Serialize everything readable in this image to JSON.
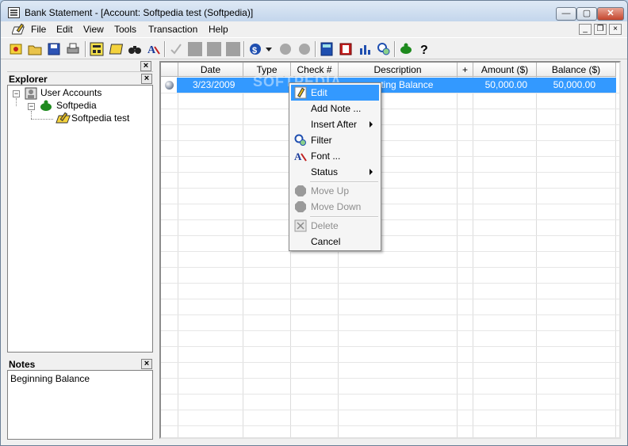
{
  "window": {
    "title": "Bank Statement - [Account: Softpedia test (Softpedia)]"
  },
  "menu": {
    "items": [
      "File",
      "Edit",
      "View",
      "Tools",
      "Transaction",
      "Help"
    ]
  },
  "explorer": {
    "title": "Explorer",
    "tree": {
      "root": "User Accounts",
      "child": "Softpedia",
      "grandchild": "Softpedia test"
    }
  },
  "notes": {
    "title": "Notes",
    "content": "Beginning Balance"
  },
  "grid": {
    "columns": [
      "Date",
      "Type",
      "Check #",
      "Description",
      "+",
      "Amount ($)",
      "Balance ($)"
    ],
    "rows": [
      {
        "date": "3/23/2009",
        "type": "",
        "check": "",
        "description": "... ting Balance",
        "amount": "50,000.00",
        "balance": "50,000.00"
      }
    ]
  },
  "context_menu": {
    "items": [
      {
        "label": "Edit",
        "state": "highlighted"
      },
      {
        "label": "Add Note ...",
        "state": "normal"
      },
      {
        "label": "Insert After",
        "state": "submenu"
      },
      {
        "label": "Filter",
        "state": "normal"
      },
      {
        "label": "Font ...",
        "state": "normal"
      },
      {
        "label": "Status",
        "state": "submenu"
      },
      {
        "label": "Move Up",
        "state": "disabled"
      },
      {
        "label": "Move Down",
        "state": "disabled"
      },
      {
        "label": "Delete",
        "state": "disabled"
      },
      {
        "label": "Cancel",
        "state": "normal"
      }
    ]
  },
  "watermark": "SOFTPEDIA",
  "colors": {
    "selection": "#3399ff",
    "close_button": "#c4452d"
  }
}
